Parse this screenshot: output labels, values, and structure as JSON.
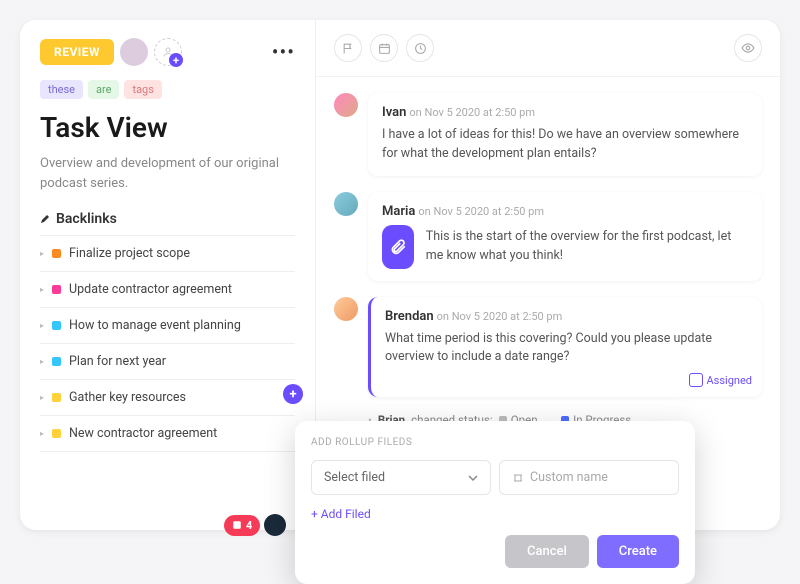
{
  "header": {
    "review_label": "REVIEW"
  },
  "tags": [
    "these",
    "are",
    "tags"
  ],
  "title": "Task View",
  "description": "Overview and development of our original podcast series.",
  "backlinks": {
    "label": "Backlinks",
    "items": [
      {
        "color": "#ff8a1f",
        "label": "Finalize project scope"
      },
      {
        "color": "#ff3b9a",
        "label": "Update contractor agreement"
      },
      {
        "color": "#35c6ff",
        "label": "How to manage event planning"
      },
      {
        "color": "#35c6ff",
        "label": "Plan for next year"
      },
      {
        "color": "#ffd23b",
        "label": "Gather key resources"
      },
      {
        "color": "#ffd23b",
        "label": "New contractor agreement"
      }
    ]
  },
  "bottom_pill": {
    "count": "4"
  },
  "comments": [
    {
      "author": "Ivan",
      "timestamp": "on Nov 5 2020 at 2:50 pm",
      "text": "I have a lot of ideas for this! Do we have an overview somewhere for what the development plan entails?"
    },
    {
      "author": "Maria",
      "timestamp": "on Nov 5 2020 at 2:50 pm",
      "text": "This is the start of the overview for the first podcast, let me know what you think!",
      "attachment": true
    },
    {
      "author": "Brendan",
      "timestamp": "on Nov 5 2020 at 2:50 pm",
      "text": "What time period is this covering? Could you please update overview to include a date range?",
      "assigned": "Assigned"
    }
  ],
  "status_change": {
    "user": "Brian",
    "verb": "changed status:",
    "from": {
      "label": "Open",
      "color": "#bdbdbd"
    },
    "to": {
      "label": "In Progress",
      "color": "#4f6cff"
    }
  },
  "modal": {
    "title": "ADD ROLLUP FILEDS",
    "select_placeholder": "Select filed",
    "custom_placeholder": "Custom name",
    "add_label": "+ Add Filed",
    "cancel": "Cancel",
    "create": "Create"
  }
}
